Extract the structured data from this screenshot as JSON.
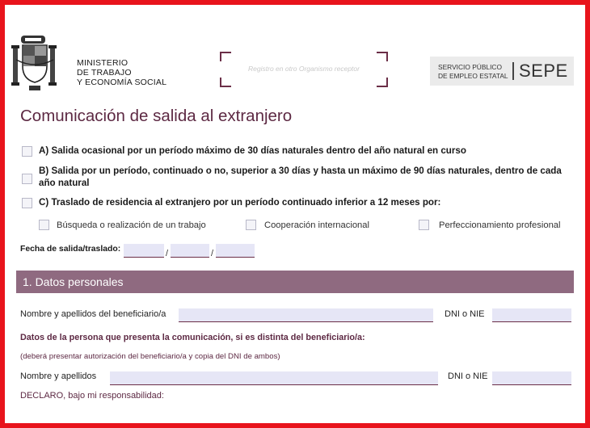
{
  "header": {
    "ministry_lines": [
      "MINISTERIO",
      "DE TRABAJO",
      "Y ECONOMÍA SOCIAL"
    ],
    "registry_placeholder": "Registro en otro Organismo receptor",
    "sepe_small_lines": [
      "SERVICIO PÚBLICO",
      "DE EMPLEO ESTATAL"
    ],
    "sepe_logo": "SEPE"
  },
  "form": {
    "title": "Comunicación de salida al extranjero",
    "options": [
      {
        "label": "A) Salida ocasional por un período máximo de 30 días naturales dentro del año natural en curso",
        "checked": false
      },
      {
        "label": "B) Salida por un período, continuado o no, superior a 30 días y hasta un máximo de 90 días naturales, dentro de cada año natural",
        "checked": false
      },
      {
        "label": "C) Traslado de residencia al extranjero por un período continuado inferior a 12 meses por:",
        "checked": false
      }
    ],
    "sub_options": [
      {
        "label": "Búsqueda o realización de un trabajo",
        "checked": false
      },
      {
        "label": "Cooperación internacional",
        "checked": false
      },
      {
        "label": "Perfeccionamiento profesional",
        "checked": false
      }
    ],
    "date_label": "Fecha de salida/traslado:",
    "date_separator": "/",
    "date_day": "",
    "date_month": "",
    "date_year": ""
  },
  "section1": {
    "heading": "1. Datos personales",
    "beneficiary_label": "Nombre y apellidos del beneficiario/a",
    "beneficiary_value": "",
    "dni_label": "DNI o NIE",
    "dni_value": "",
    "presenter_heading": "Datos de la persona que presenta la comunicación, si es distinta del beneficiario/a:",
    "presenter_note": "(deberá presentar autorización del beneficiario/a y copia del DNI de ambos)",
    "presenter_name_label": "Nombre y apellidos",
    "presenter_name_value": "",
    "presenter_dni_label": "DNI o NIE",
    "presenter_dni_value": "",
    "declaro": "DECLARO, bajo mi responsabilidad:"
  },
  "colors": {
    "frame_red": "#e8141c",
    "accent_maroon": "#5d2943",
    "section_bar": "#8f6a80",
    "field_fill": "#e6e6f6"
  }
}
